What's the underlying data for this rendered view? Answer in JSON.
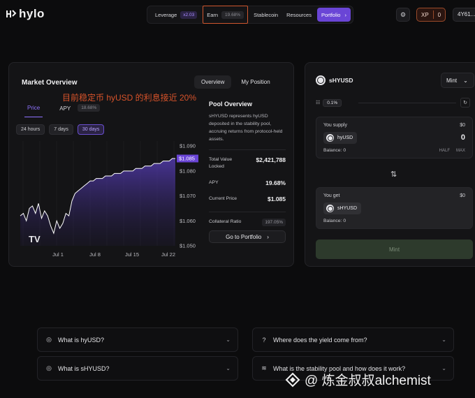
{
  "brand": {
    "name": "hylo"
  },
  "nav": {
    "leverage_label": "Leverage",
    "leverage_badge": "x2.03",
    "earn_label": "Earn",
    "earn_badge": "19.68%",
    "stablecoin_label": "Stablecoin",
    "resources_label": "Resources",
    "portfolio_label": "Portfolio"
  },
  "header": {
    "xp_label": "XP",
    "xp_value": "0",
    "wallet": "4Y61..."
  },
  "market": {
    "title": "Market Overview",
    "tabs": [
      "Overview",
      "My Position"
    ],
    "annotation": "目前稳定币 hyUSD 的利息接近 20%",
    "subtabs": {
      "price": "Price",
      "apy": "APY",
      "apy_badge": "18.68%"
    },
    "ranges": [
      "24 hours",
      "7 days",
      "30 days"
    ],
    "active_range": "30 days"
  },
  "pool": {
    "title": "Pool Overview",
    "description": "sHYUSD represents hyUSD deposited in the stability pool, accruing returns from protocol-held assets.",
    "tvl_label": "Total Value Locked",
    "tvl_value": "$2,421,788",
    "apy_label": "APY",
    "apy_value": "19.68%",
    "price_label": "Current Price",
    "price_value": "$1.085",
    "collateral_label": "Collateral Ratio",
    "collateral_value": "197.05%",
    "goto_label": "Go to Portfolio"
  },
  "swap": {
    "token": "sHYUSD",
    "mode": "Mint",
    "slippage": "0.1%",
    "supply_label": "You supply",
    "supply_usd": "$0",
    "supply_token": "hyUSD",
    "supply_amount": "0",
    "supply_balance": "Balance: 0",
    "half": "HALF",
    "max": "MAX",
    "get_label": "You get",
    "get_usd": "$0",
    "get_token": "sHYUSD",
    "get_balance": "Balance: 0",
    "mint_label": "Mint"
  },
  "faq": [
    {
      "q": "What is hyUSD?"
    },
    {
      "q": "Where does the yield come from?"
    },
    {
      "q": "What is sHYUSD?"
    },
    {
      "q": "What is the stability pool and how does it work?"
    }
  ],
  "watermark": "@ 炼金叔叔alchemist",
  "chart_data": {
    "type": "area",
    "x_ticks": [
      "Jul 1",
      "Jul 8",
      "Jul 15",
      "Jul 22"
    ],
    "y_ticks": [
      "$1.090",
      "$1.080",
      "$1.070",
      "$1.060",
      "$1.050"
    ],
    "ylim": [
      1.05,
      1.092
    ],
    "last_value_label": "$1.085",
    "y": [
      1.062,
      1.063,
      1.06,
      1.065,
      1.066,
      1.063,
      1.067,
      1.061,
      1.064,
      1.062,
      1.058,
      1.055,
      1.06,
      1.057,
      1.059,
      1.063,
      1.062,
      1.068,
      1.071,
      1.072,
      1.073,
      1.074,
      1.075,
      1.076,
      1.076,
      1.077,
      1.077,
      1.077,
      1.078,
      1.078,
      1.078,
      1.079,
      1.079,
      1.079,
      1.08,
      1.08,
      1.08,
      1.08,
      1.081,
      1.081,
      1.081,
      1.082,
      1.082,
      1.082,
      1.083,
      1.083,
      1.083,
      1.084,
      1.084,
      1.084,
      1.085,
      1.085
    ],
    "accent": "#6a45d6"
  }
}
